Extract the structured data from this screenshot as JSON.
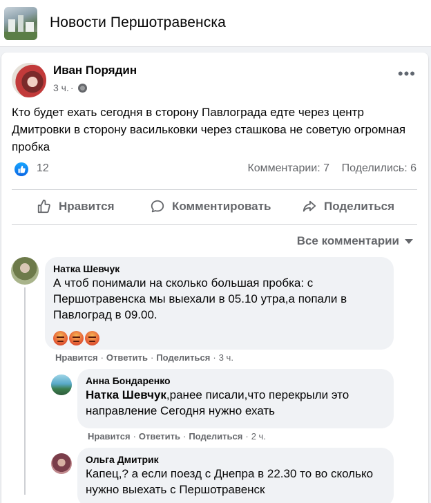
{
  "group": {
    "title": "Новости Першотравенска",
    "thumb_icon": "group-thumbnail"
  },
  "post": {
    "author": "Иван Порядин",
    "time": "3 ч.",
    "separator": "·",
    "privacy_icon": "globe-icon",
    "more_icon": "more-dots-icon",
    "more_label": "•••",
    "text": "Кто будет ехать сегодня в сторону Павлограда едте через центр Дмитровки в сторону васильковки через сташкова не советую огромная пробка",
    "reactions": {
      "icon": "like-icon",
      "count": "12"
    },
    "comments_count": "Комментарии: 7",
    "shares_count": "Поделились: 6",
    "actions": {
      "like": "Нравится",
      "comment": "Комментировать",
      "share": "Поделиться"
    },
    "sort_label": "Все комментарии"
  },
  "comments": [
    {
      "name": "Натка Шевчук",
      "text": "А чтоб понимали на сколько большая пробка: с Першотравенска мы выехали в 05.10 утра,а попали в Павлоград в 09.00.",
      "emoji": [
        "angry-face",
        "angry-face",
        "angry-face"
      ],
      "like": "Нравится",
      "reply": "Ответить",
      "share": "Поделиться",
      "time": "3 ч."
    },
    {
      "name": "Анна Бондаренко",
      "mention": "Натка Шевчук",
      "text": ",ранее писали,что перекрыли это направление Сегодня нужно ехать",
      "like": "Нравится",
      "reply": "Ответить",
      "share": "Поделиться",
      "time": "2 ч."
    },
    {
      "name": "Ольга Дмитрик",
      "text": "Капец,? а если поезд с Днепра в 22.30 то во сколько нужно выехать с Першотравенск"
    }
  ],
  "colors": {
    "background": "#f0f2f5",
    "card": "#ffffff",
    "secondary_text": "#65676b",
    "like_blue": "#0a66e4"
  }
}
